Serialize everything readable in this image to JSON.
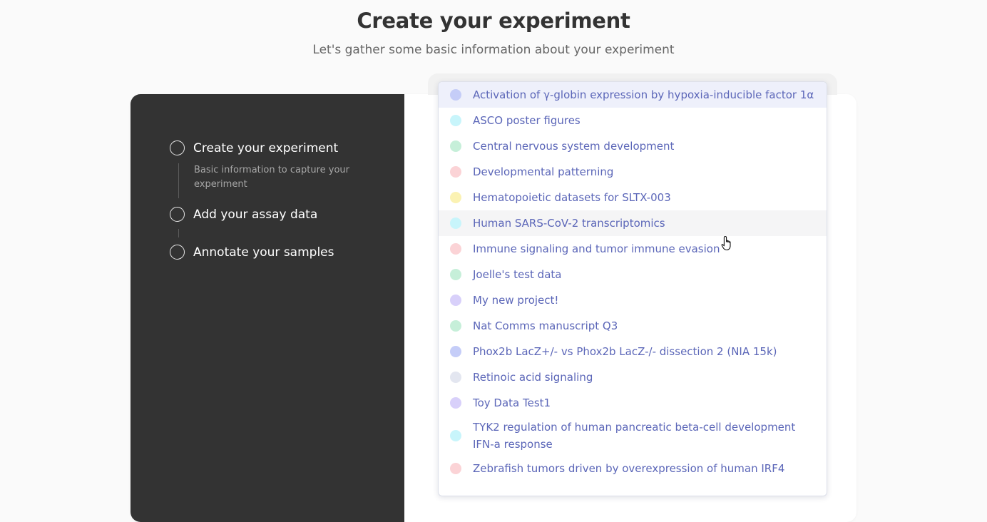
{
  "header": {
    "title": "Create your experiment",
    "subtitle": "Let's gather some basic information about your experiment"
  },
  "stepper": {
    "steps": [
      {
        "label": "Create your experiment",
        "description": "Basic information to capture your experiment"
      },
      {
        "label": "Add your assay data"
      },
      {
        "label": "Annotate your samples"
      }
    ]
  },
  "dropdown": {
    "options": [
      {
        "label": "Activation of γ-globin expression by hypoxia-inducible factor 1α",
        "color": "#c5cdf8"
      },
      {
        "label": "ASCO poster figures",
        "color": "#c8f5fb"
      },
      {
        "label": "Central nervous system development",
        "color": "#c6efd9"
      },
      {
        "label": "Developmental patterning",
        "color": "#fbd3d6"
      },
      {
        "label": "Hematopoietic datasets for SLTX-003",
        "color": "#fbf2b3"
      },
      {
        "label": "Human SARS-CoV-2 transcriptomics",
        "color": "#c8f5fb"
      },
      {
        "label": "Immune signaling and tumor immune evasion",
        "color": "#fbd3d6"
      },
      {
        "label": "Joelle's test data",
        "color": "#c6efd9"
      },
      {
        "label": "My new project!",
        "color": "#d8d0fa"
      },
      {
        "label": "Nat Comms manuscript Q3",
        "color": "#c6efd9"
      },
      {
        "label": "Phox2b LacZ+/- vs Phox2b LacZ-/- dissection 2 (NIA 15k)",
        "color": "#c5cdf8"
      },
      {
        "label": "Retinoic acid signaling",
        "color": "#e3e6f0"
      },
      {
        "label": "Toy Data Test1",
        "color": "#d8d0fa"
      },
      {
        "label": "TYK2 regulation of human pancreatic beta-cell development IFN-a response",
        "color": "#c8f5fb"
      },
      {
        "label": "Zebrafish tumors driven by overexpression of human IRF4",
        "color": "#fbd3d6"
      }
    ]
  }
}
